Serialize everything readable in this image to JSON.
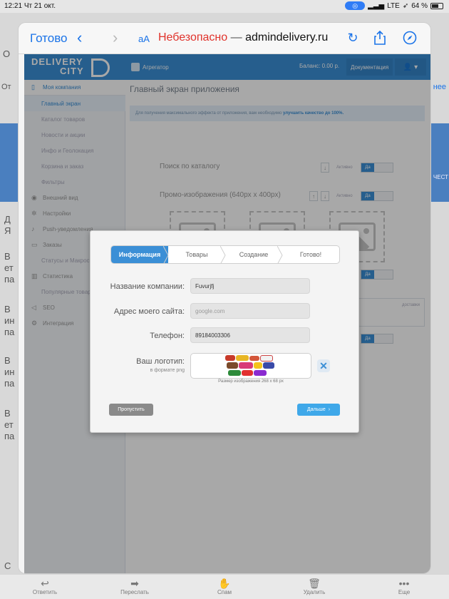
{
  "status_bar": {
    "time": "12:21",
    "date": "Чт 21 окт.",
    "network": "LTE",
    "battery": "64 %"
  },
  "background_mail": {
    "edge_left_items": [
      "О",
      "От",
      "Д",
      "Я",
      "В",
      "ет",
      "па",
      "В",
      "ин",
      "па",
      "В",
      "ин",
      "па",
      "В",
      "ет",
      "па",
      "С"
    ],
    "edge_right": "нее",
    "edge_right_2": "ЧЕСТ"
  },
  "mail_toolbar": {
    "reply": "Ответить",
    "forward": "Переслать",
    "spam": "Спам",
    "delete": "Удалить",
    "more": "Еще"
  },
  "browser": {
    "done": "Готово",
    "aa": "аА",
    "insecure": "Небезопасно",
    "dash": "—",
    "host": "admindelivery.ru"
  },
  "site": {
    "logo_line1": "DELIVERY",
    "logo_line2": "CITY",
    "user": "Агрегатор",
    "balance": "Баланс: 0.00 р.",
    "docs": "Документация",
    "sidebar": [
      {
        "label": "Моя компания",
        "icon": "phone-icon",
        "type": "active"
      },
      {
        "label": "Главный экран",
        "type": "sub-sel"
      },
      {
        "label": "Каталог товаров",
        "type": "sub"
      },
      {
        "label": "Новости и акции",
        "type": "sub"
      },
      {
        "label": "Инфо и Геолокация",
        "type": "sub"
      },
      {
        "label": "Корзина и заказ",
        "type": "sub"
      },
      {
        "label": "Фильтры",
        "type": "sub"
      },
      {
        "label": "Внешний вид",
        "icon": "eye-icon",
        "type": "top"
      },
      {
        "label": "Настройки",
        "icon": "gear-icon",
        "type": "top"
      },
      {
        "label": "Push-уведомления",
        "icon": "bell-icon",
        "type": "top"
      },
      {
        "label": "Заказы",
        "icon": "card-icon",
        "type": "top"
      },
      {
        "label": "Статусы и Макросы",
        "type": "sub"
      },
      {
        "label": "Статистика",
        "icon": "chart-icon",
        "type": "top"
      },
      {
        "label": "Популярные товары",
        "type": "sub"
      },
      {
        "label": "SEO",
        "icon": "megaphone-icon",
        "type": "top"
      },
      {
        "label": "Интеграция",
        "icon": "cogs-icon",
        "type": "top"
      }
    ],
    "main_title": "Главный экран приложения",
    "hint_text": "Для получения максимального эффекта от приложения, вам необходимо",
    "hint_bold": "улучшить качество до 100%.",
    "row1_label": "Поиск по каталогу",
    "row2_label": "Промо-изображения (640px x 400px)",
    "toggle_active": "Активно",
    "toggle_yes": "Да",
    "textarea_hint": "доставки"
  },
  "modal": {
    "steps": [
      "Информация",
      "Товары",
      "Создание",
      "Готово!"
    ],
    "active_step": 0,
    "company_label": "Название компании:",
    "company_value": "Fuvurjfj",
    "site_label": "Адрес моего сайта:",
    "site_placeholder": "google.com",
    "phone_label": "Телефон:",
    "phone_value": "89184003306",
    "logo_label": "Ваш логотип:",
    "logo_sub": "в формате png",
    "size_note": "Размер изображения 268 x 68 px",
    "skip": "Пропустить",
    "next": "Дальше"
  }
}
